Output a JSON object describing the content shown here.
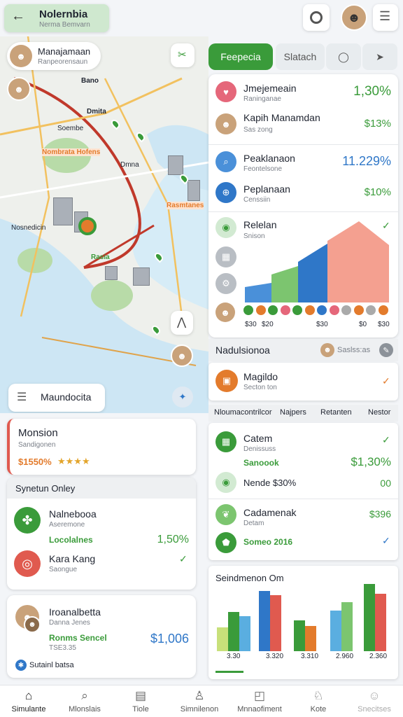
{
  "header": {
    "title": "Nolernbia",
    "subtitle": "Nerma Bemvarn"
  },
  "map": {
    "profile_title": "Manajamaan",
    "profile_sub": "Ranpeorensaun",
    "place_labels": [
      "Bano",
      "Soembe",
      "Dmita",
      "Dmna",
      "Nombrata Hofens",
      "Rasmtanes",
      "Nosnedicin",
      "Rasia"
    ],
    "zoom_icon": "scissors-icon",
    "locate_icon": "arrow-icon",
    "compass_icon": "compass-icon",
    "bottom_label": "Maundocita"
  },
  "tabs": [
    "Feepecia",
    "Slatach"
  ],
  "list_top": [
    {
      "title": "Jmejemeain",
      "sub": "Raninganae",
      "value": "1,30%",
      "color": "#e5677a"
    },
    {
      "title": "Kapih Manamdan",
      "sub": "Sas zong",
      "value": "$13%",
      "color": "#3a9b3a"
    },
    {
      "title": "Peaklanaon",
      "sub": "Feontelsone",
      "value": "11.229%",
      "color": "#2f77c8"
    },
    {
      "title": "Peplanaan",
      "sub": "Censsiin",
      "value": "$10%",
      "color": "#3a9b3a"
    }
  ],
  "area_panel": {
    "title": "Relelan",
    "sub": "Snison",
    "legend_dots": [
      "#3a9b3a",
      "#e37b2c",
      "#3a9b3a",
      "#e5677a",
      "#3a9b3a",
      "#e37b2c",
      "#2f77c8",
      "#e5677a",
      "#aaaaaa",
      "#e37b2c",
      "#aaaaaa",
      "#e37b2c"
    ],
    "axis": [
      "$30",
      "$20",
      "$30",
      "$0",
      "$30"
    ]
  },
  "section_bar": {
    "title": "Nadulsionoa",
    "right_label": "Saslss:as"
  },
  "magildo": {
    "title": "Magildo",
    "sub": "Secton ton"
  },
  "col_headers": [
    "Nloumacontrilcor",
    "Najpers",
    "Retanten",
    "Nestor"
  ],
  "list_mid": [
    {
      "title": "Catem",
      "sub": "Denissuss",
      "extra": "Sanoook",
      "value": "$1,30%"
    },
    {
      "title": "Nende $30%",
      "sub": "",
      "value": "00"
    },
    {
      "title": "Cadamenak",
      "sub": "Detam",
      "value": "$396"
    },
    {
      "title": "Someo 2016",
      "sub": "",
      "value": ""
    }
  ],
  "bar_panel": {
    "title": "Seindmenon Om",
    "axis": [
      "3.30",
      "3.320",
      "3.310",
      "2.960",
      "2.360"
    ]
  },
  "left_cards": {
    "monsion": {
      "title": "Monsion",
      "sub": "Sandigonen",
      "price": "$1550%",
      "rating": 4
    },
    "section_label": "Synetun Onley",
    "item1": {
      "title": "Nalnebooa",
      "sub": "Aseremone",
      "tag": "Locolalnes",
      "value": "1,50%"
    },
    "item2": {
      "title": "Kara Kang",
      "sub": "Saongue"
    },
    "person": {
      "title": "Iroanalbetta",
      "sub": "Danna Jenes",
      "tag": "Ronms Sencel",
      "sub2": "TSE3.35",
      "value": "$1,006",
      "footer": "Sutainl batsa"
    }
  },
  "bottom_nav": [
    "Simulante",
    "Mlonslais",
    "Tiole",
    "Simnilenon",
    "Mnnaofiment",
    "Kote",
    "Snecitses"
  ],
  "colors": {
    "accent_green": "#3a9b3a",
    "blue": "#2f77c8",
    "orange": "#e37b2c",
    "pink": "#e5677a",
    "salmon": "#f4a090"
  }
}
